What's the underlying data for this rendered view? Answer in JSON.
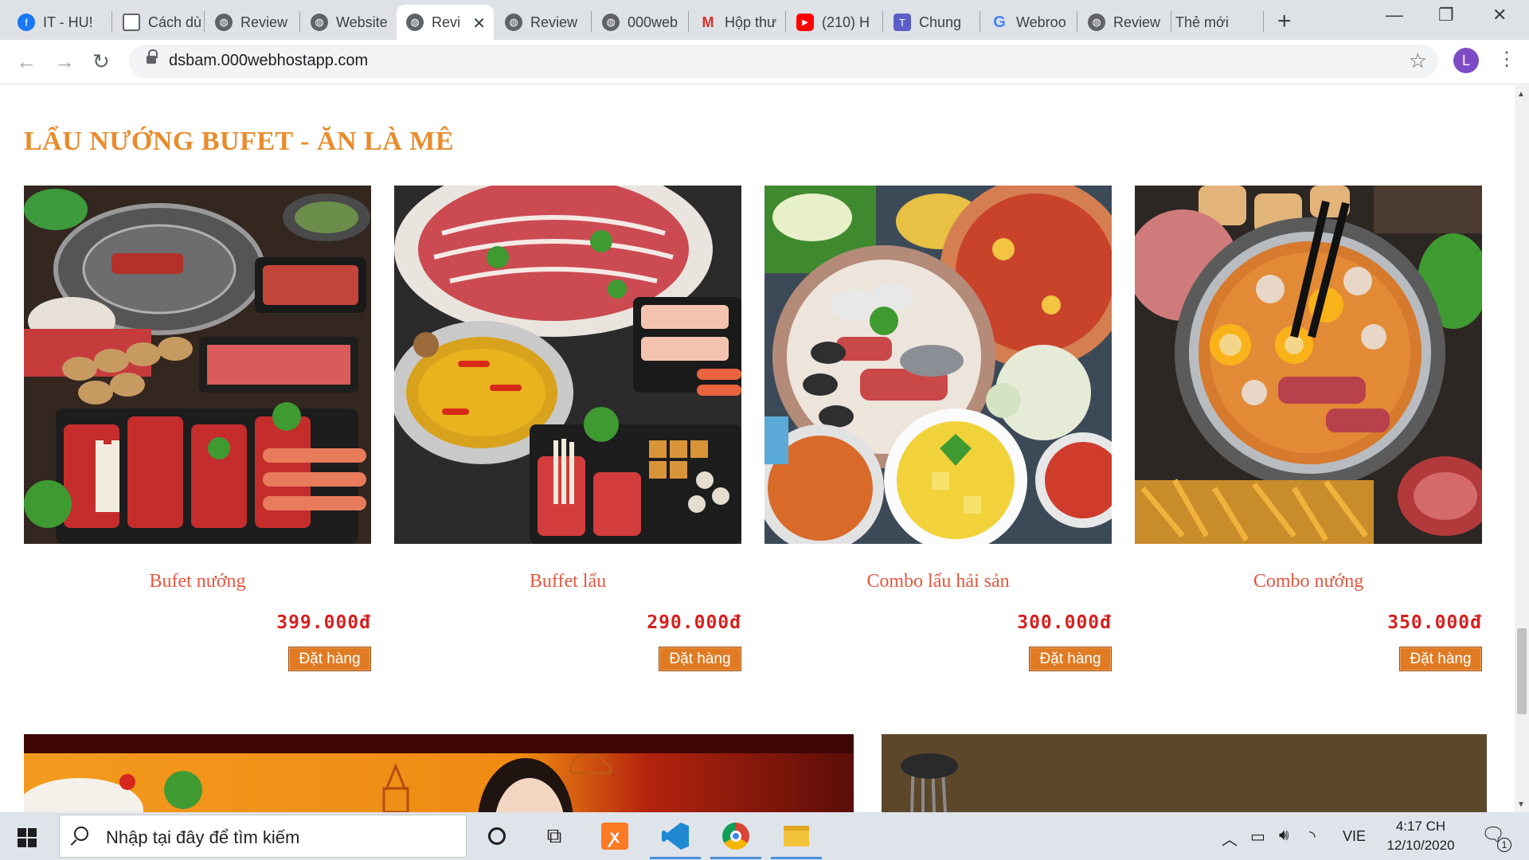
{
  "browser": {
    "tabs": [
      {
        "label": "IT - HU!",
        "icon": "facebook-icon",
        "color": "#1877f2"
      },
      {
        "label": "Cách dù",
        "icon": "document-icon",
        "color": "#5f6368"
      },
      {
        "label": "Review",
        "icon": "globe-icon",
        "color": "#5f6368"
      },
      {
        "label": "Website",
        "icon": "globe-icon",
        "color": "#5f6368"
      },
      {
        "label": "Revi",
        "icon": "globe-icon",
        "color": "#5f6368",
        "active": true
      },
      {
        "label": "Review",
        "icon": "globe-icon",
        "color": "#5f6368"
      },
      {
        "label": "000web",
        "icon": "globe-icon",
        "color": "#5f6368"
      },
      {
        "label": "Hộp thư",
        "icon": "gmail-icon",
        "color": "#d93025"
      },
      {
        "label": "(210) H",
        "icon": "youtube-icon",
        "color": "#ff0000"
      },
      {
        "label": "Chung",
        "icon": "teams-icon",
        "color": "#5b5fc7"
      },
      {
        "label": "Webroo",
        "icon": "google-icon",
        "color": "#4285f4"
      },
      {
        "label": "Review",
        "icon": "globe-icon",
        "color": "#5f6368"
      },
      {
        "label": "Thẻ mới",
        "icon": "",
        "color": "#5f6368"
      }
    ],
    "url": "dsbam.000webhostapp.com",
    "profile_initial": "L"
  },
  "page": {
    "section_title": "LẨU NƯỚNG BUFET - ĂN LÀ MÊ",
    "products": [
      {
        "name": "Bufet nướng",
        "price": "399.000đ",
        "order_label": "Đặt hàng"
      },
      {
        "name": "Buffet lẩu",
        "price": "290.000đ",
        "order_label": "Đặt hàng"
      },
      {
        "name": "Combo lẩu hải sản",
        "price": "300.000đ",
        "order_label": "Đặt hàng"
      },
      {
        "name": "Combo nướng",
        "price": "350.000đ",
        "order_label": "Đặt hàng"
      }
    ],
    "accent_color": "#e88c2c",
    "price_color": "#d62020",
    "button_color": "#e07b23"
  },
  "taskbar": {
    "search_placeholder": "Nhập tại đây để tìm kiếm",
    "language": "VIE",
    "time": "4:17 CH",
    "date": "12/10/2020",
    "notification_count": "1"
  }
}
